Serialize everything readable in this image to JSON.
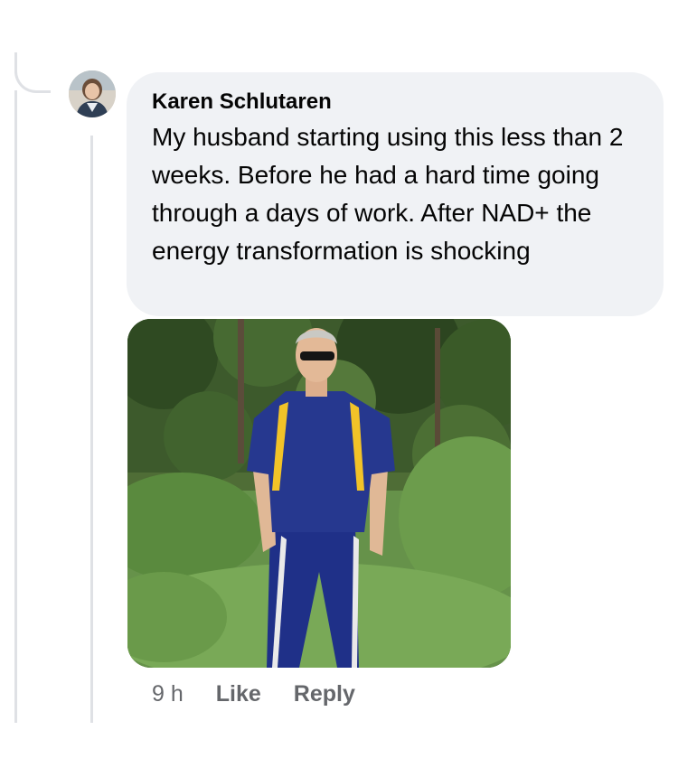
{
  "comment": {
    "author": "Karen Schlutaren",
    "text": "My husband starting using this less than 2 weeks. Before he had a hard time going through a days of work. After NAD+ the energy transformation is shocking",
    "timestamp": "9 h",
    "like_label": "Like",
    "reply_label": "Reply"
  },
  "icons": {
    "avatar": "profile-photo",
    "attachment": "photo-man-in-blue-tracksuit-standing-in-greenery"
  },
  "colors": {
    "bubble_background": "#f0f2f5",
    "secondary_text": "#65676b",
    "thread_line": "#dfe1e5"
  }
}
